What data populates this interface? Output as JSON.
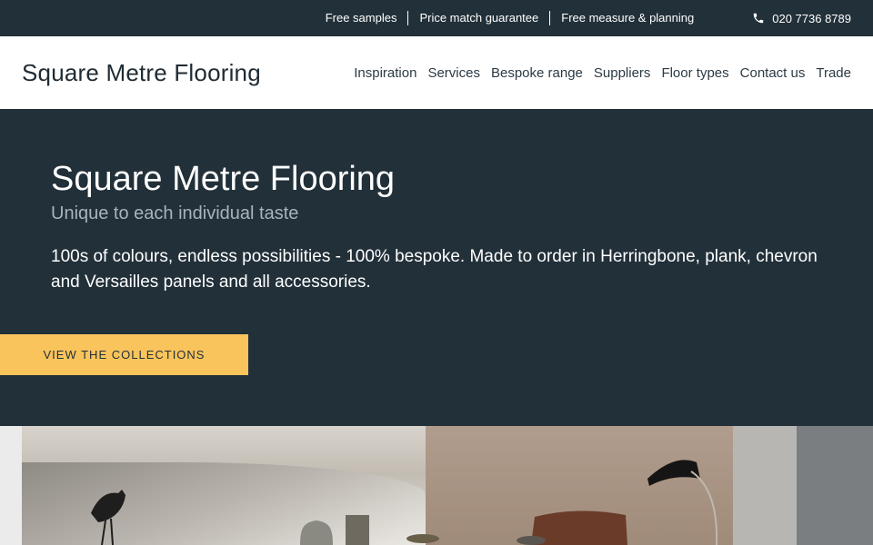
{
  "topbar": {
    "links": [
      "Free samples",
      "Price match guarantee",
      "Free measure & planning"
    ],
    "phone": "020 7736 8789"
  },
  "header": {
    "logo": "Square Metre Flooring",
    "nav": [
      "Inspiration",
      "Services",
      "Bespoke range",
      "Suppliers",
      "Floor types",
      "Contact us",
      "Trade"
    ]
  },
  "hero": {
    "title": "Square Metre Flooring",
    "subtitle": "Unique to each individual taste",
    "description": "100s of colours, endless possibilities - 100% bespoke. Made to order in Herringbone, plank, chevron and Versailles panels and all accessories.",
    "cta": "VIEW THE COLLECTIONS"
  },
  "colors": {
    "dark": "#223039",
    "accent": "#fac45c"
  },
  "icons": {
    "phone": "phone-icon"
  }
}
